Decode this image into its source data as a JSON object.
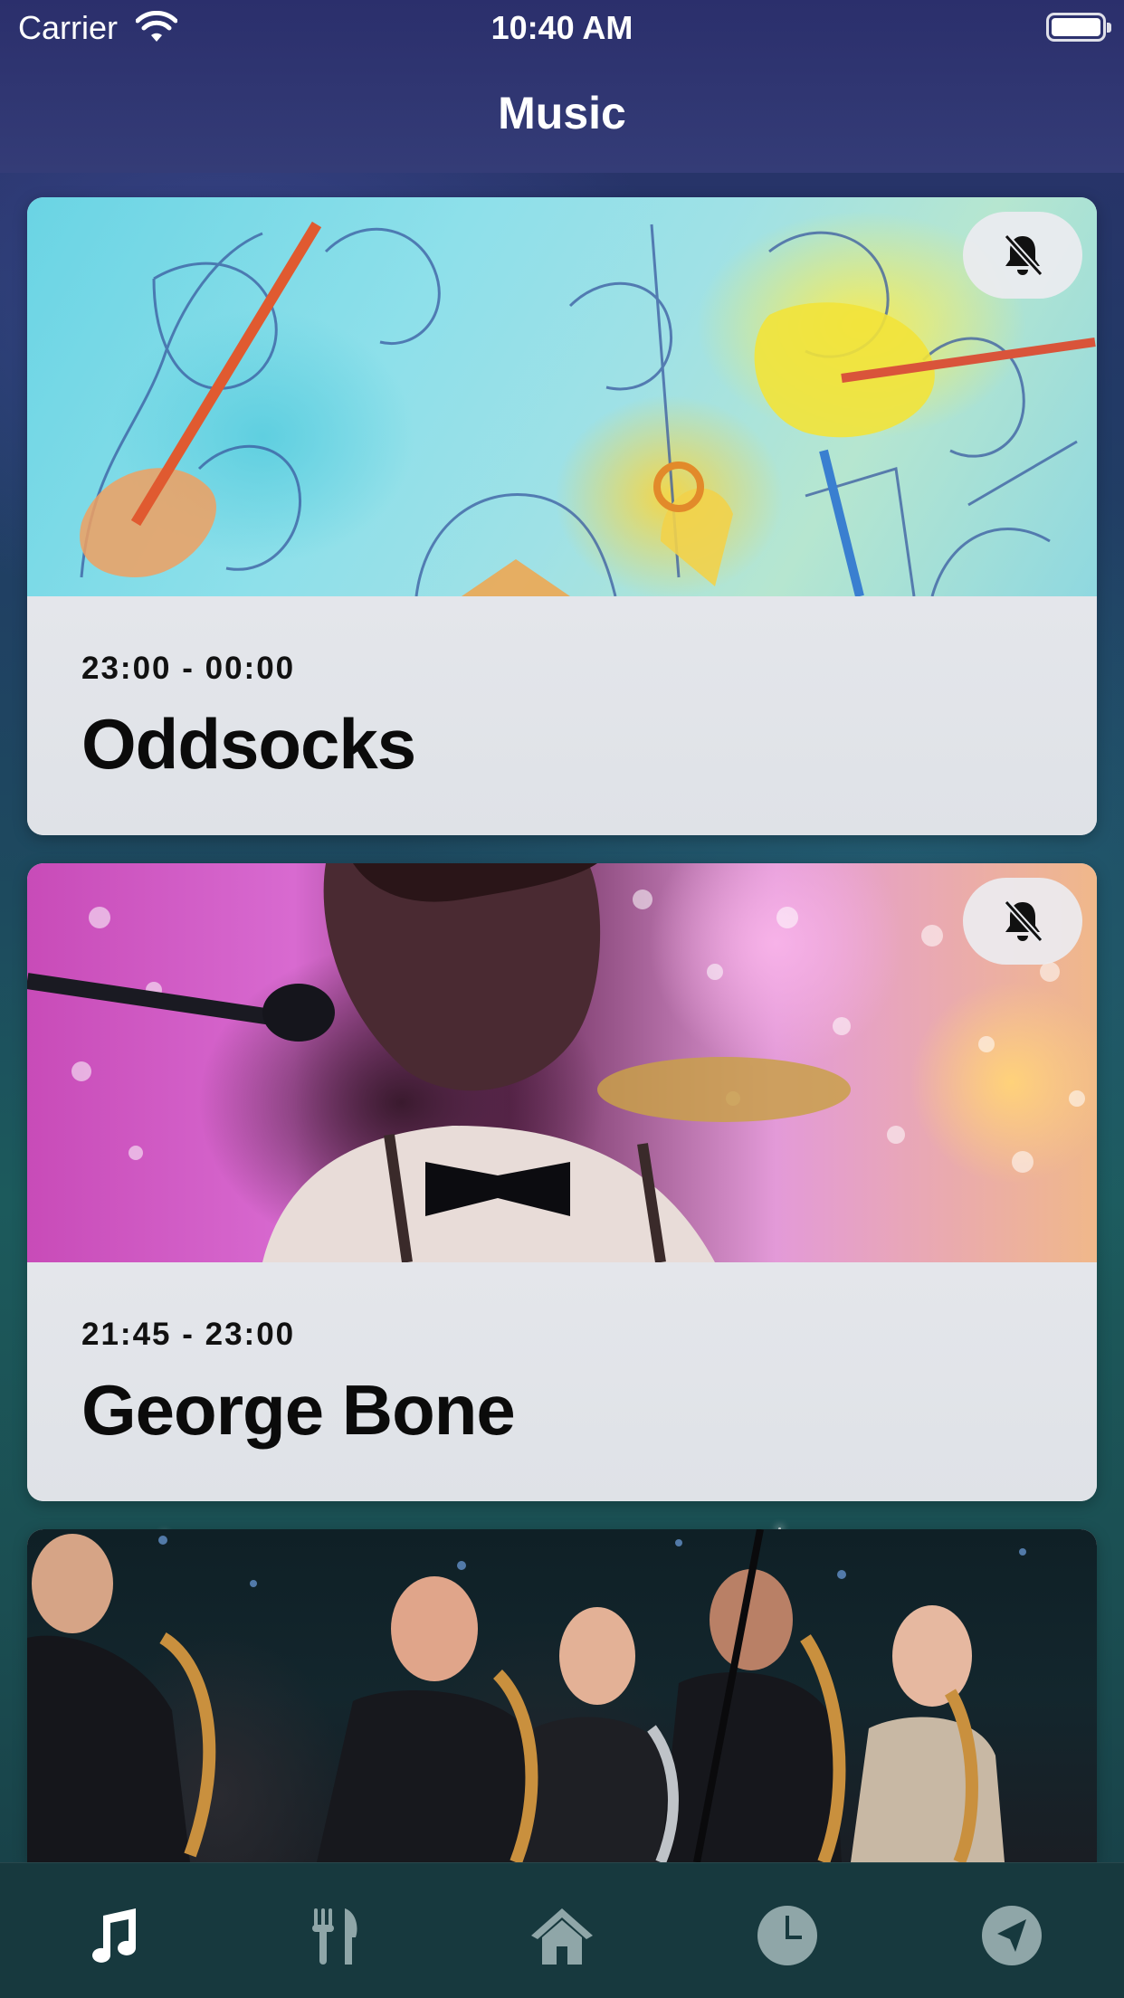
{
  "status_bar": {
    "carrier": "Carrier",
    "time": "10:40 AM"
  },
  "nav": {
    "title": "Music"
  },
  "cards": [
    {
      "time": "23:00 - 00:00",
      "title": "Oddsocks",
      "image_icon": "oddsocks-artwork",
      "notify_icon": "bell-slash-icon"
    },
    {
      "time": "21:45 - 23:00",
      "title": "George Bone",
      "image_icon": "george-bone-photo",
      "notify_icon": "bell-slash-icon"
    },
    {
      "image_icon": "saxophone-band-photo"
    }
  ],
  "tab_bar": {
    "items": [
      {
        "icon": "music-note-icon",
        "active": true
      },
      {
        "icon": "fork-knife-icon",
        "active": false
      },
      {
        "icon": "house-icon",
        "active": false
      },
      {
        "icon": "clock-icon",
        "active": false
      },
      {
        "icon": "location-arrow-icon",
        "active": false
      }
    ]
  },
  "colors": {
    "tab_active": "#ffffff",
    "tab_inactive": "#8fa6a8",
    "nav_bg": "#2b2f6c"
  }
}
